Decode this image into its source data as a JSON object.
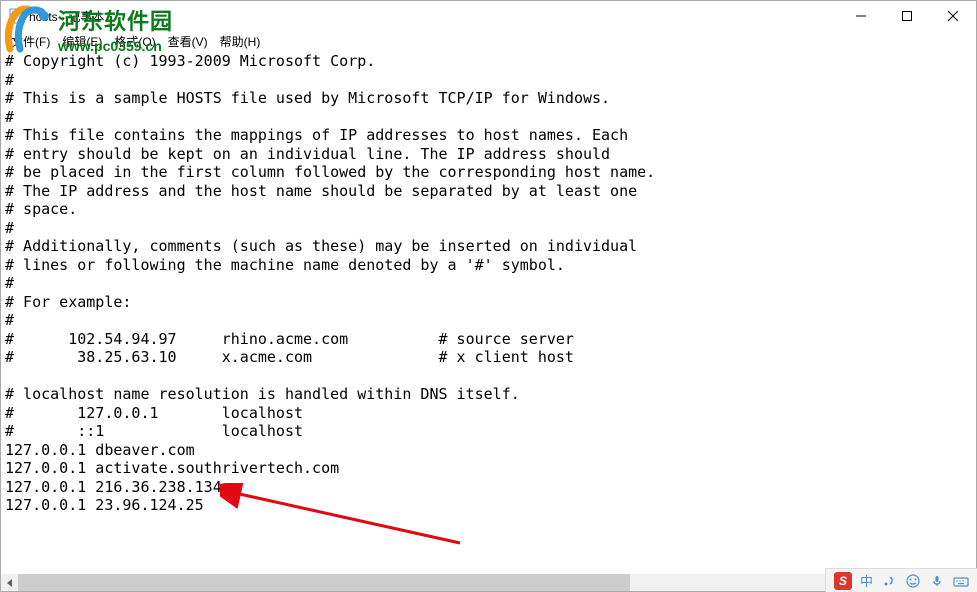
{
  "window": {
    "title": "hosts - 记事本"
  },
  "menubar": {
    "file": "文件(F)",
    "edit": "编辑(E)",
    "format": "格式(O)",
    "view": "查看(V)",
    "help": "帮助(H)"
  },
  "content": {
    "text": "# Copyright (c) 1993-2009 Microsoft Corp.\n#\n# This is a sample HOSTS file used by Microsoft TCP/IP for Windows.\n#\n# This file contains the mappings of IP addresses to host names. Each\n# entry should be kept on an individual line. The IP address should\n# be placed in the first column followed by the corresponding host name.\n# The IP address and the host name should be separated by at least one\n# space.\n#\n# Additionally, comments (such as these) may be inserted on individual\n# lines or following the machine name denoted by a '#' symbol.\n#\n# For example:\n#\n#      102.54.94.97     rhino.acme.com          # source server\n#       38.25.63.10     x.acme.com              # x client host\n\n# localhost name resolution is handled within DNS itself.\n#       127.0.0.1       localhost\n#       ::1             localhost\n127.0.0.1 dbeaver.com\n127.0.0.1 activate.southrivertech.com\n127.0.0.1 216.36.238.134\n127.0.0.1 23.96.124.25"
  },
  "watermark": {
    "cn": "河东软件园",
    "url": "www.pc0359.cn"
  },
  "tray": {
    "ime_label": "S",
    "cn_label": "中"
  }
}
